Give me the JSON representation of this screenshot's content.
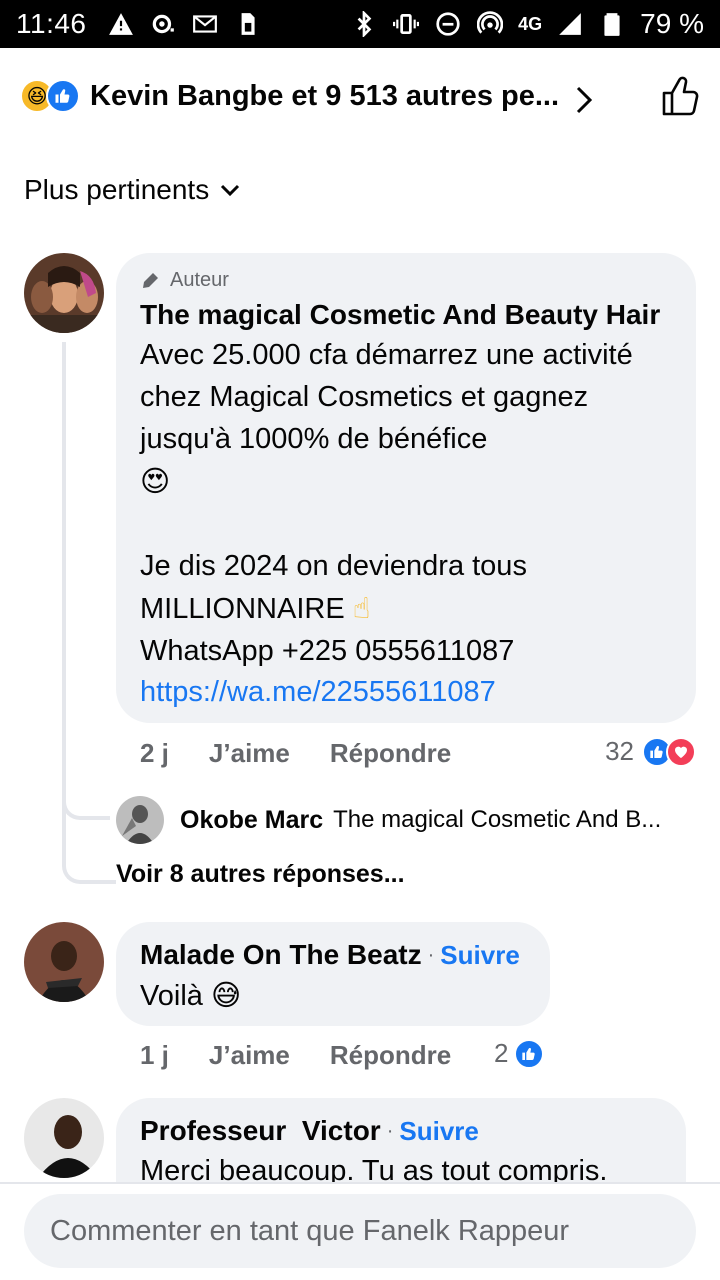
{
  "status_bar": {
    "time": "11:46",
    "network": "4G",
    "battery": "79 %"
  },
  "reactions": {
    "summary": "Kevin Bangbe et 9 513 autres pe..."
  },
  "sort": {
    "label": "Plus pertinents"
  },
  "comments": [
    {
      "badge": "Auteur",
      "name": "The magical Cosmetic And Beauty Hair",
      "text_1": "Avec 25.000 cfa démarrez une activité chez Magical Cosmetics et gagnez jusqu'à 1000% de bénéfice",
      "emoji_1": "😍",
      "text_2": "Je dis 2024 on deviendra tous MILLIONNAIRE",
      "emoji_2": "☝",
      "text_3": "WhatsApp +225 0555611087",
      "link": "https://wa.me/22555611087",
      "time": "2 j",
      "like_label": "J’aime",
      "reply_label": "Répondre",
      "reaction_count": "32",
      "reply": {
        "name": "Okobe Marc",
        "text": "The magical Cosmetic And B..."
      },
      "more_replies": "Voir 8 autres réponses..."
    },
    {
      "name": "Malade On The Beatz",
      "follow": "Suivre",
      "text": "Voilà",
      "emoji": "😅",
      "time": "1 j",
      "like_label": "J’aime",
      "reply_label": "Répondre",
      "reaction_count": "2"
    },
    {
      "name": "Professeur  Victor",
      "follow": "Suivre",
      "text": "Merci beaucoup. Tu as tout compris."
    }
  ],
  "composer": {
    "placeholder": "Commenter en tant que Fanelk Rappeur"
  },
  "colors": {
    "accent": "#1877f2",
    "bubble": "#f0f2f5",
    "meta": "#65676b",
    "love": "#f33e58"
  }
}
